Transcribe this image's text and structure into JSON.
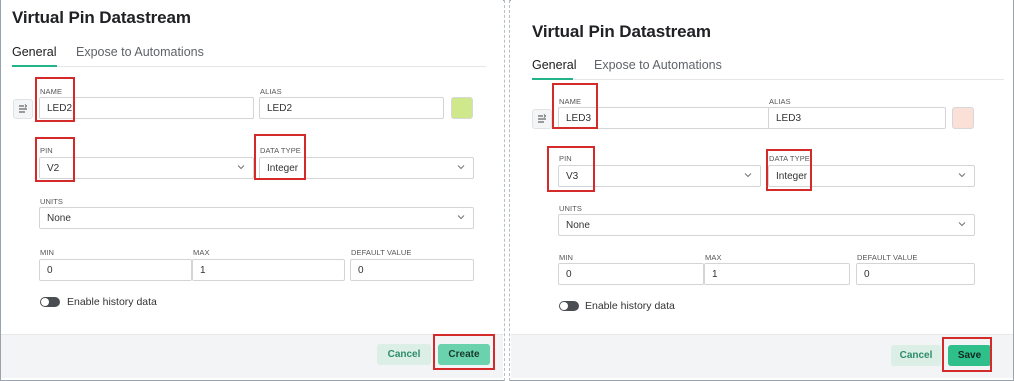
{
  "left": {
    "title": "Virtual Pin Datastream",
    "tabs": [
      {
        "label": "General"
      },
      {
        "label": "Expose to Automations"
      }
    ],
    "name": {
      "label": "NAME",
      "value": "LED2"
    },
    "alias": {
      "label": "ALIAS",
      "value": "LED2"
    },
    "color": "#cfe88c",
    "pin": {
      "label": "PIN",
      "value": "V2"
    },
    "data_type": {
      "label": "DATA TYPE",
      "value": "Integer"
    },
    "units": {
      "label": "UNITS",
      "value": "None"
    },
    "min": {
      "label": "MIN",
      "value": "0"
    },
    "max": {
      "label": "MAX",
      "value": "1"
    },
    "default_value": {
      "label": "DEFAULT VALUE",
      "value": "0"
    },
    "history_toggle": {
      "label": "Enable history data",
      "on": false
    },
    "cancel": "Cancel",
    "primary": "Create"
  },
  "right": {
    "title": "Virtual Pin Datastream",
    "tabs": [
      {
        "label": "General"
      },
      {
        "label": "Expose to Automations"
      }
    ],
    "name": {
      "label": "NAME",
      "value": "LED3"
    },
    "alias": {
      "label": "ALIAS",
      "value": "LED3"
    },
    "color": "#fbe0d8",
    "pin": {
      "label": "PIN",
      "value": "V3"
    },
    "data_type": {
      "label": "DATA TYPE",
      "value": "Integer"
    },
    "units": {
      "label": "UNITS",
      "value": "None"
    },
    "min": {
      "label": "MIN",
      "value": "0"
    },
    "max": {
      "label": "MAX",
      "value": "1"
    },
    "default_value": {
      "label": "DEFAULT VALUE",
      "value": "0"
    },
    "history_toggle": {
      "label": "Enable history data",
      "on": false
    },
    "cancel": "Cancel",
    "primary": "Save"
  },
  "highlight_color": "#d42a2a"
}
